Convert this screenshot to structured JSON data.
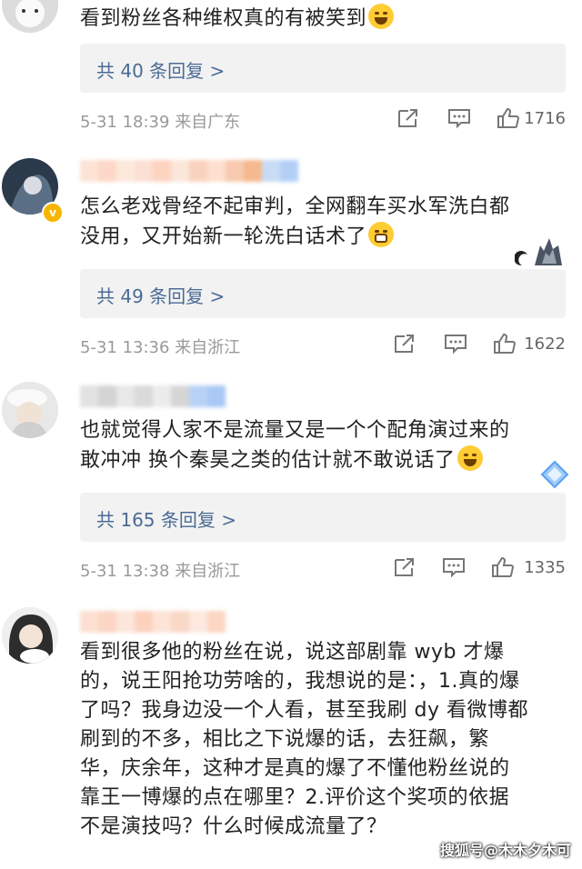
{
  "comments": [
    {
      "text": "看到粉丝各种维权真的有被笑到",
      "replies_label": "共 40 条回复 >",
      "time": "5-31 18:39",
      "location": "来自广东",
      "likes": "1716"
    },
    {
      "text_line1": "怎么老戏骨经不起审判，全网翻车买水军洗白都",
      "text_line2": "没用，又开始新一轮洗白话术了",
      "replies_label": "共 49 条回复 >",
      "time": "5-31 13:36",
      "location": "来自浙江",
      "likes": "1622"
    },
    {
      "text_line1": "也就觉得人家不是流量又是一个个配角演过来的",
      "text_line2": "敢冲冲  换个秦昊之类的估计就不敢说话了",
      "replies_label": "共 165 条回复 >",
      "time": "5-31 13:38",
      "location": "来自浙江",
      "likes": "1335"
    },
    {
      "lines": [
        "看到很多他的粉丝在说，说这部剧靠 wyb 才爆",
        "的，说王阳抢功劳啥的，我想说的是：，1.真的爆",
        "了吗？我身边没一个人看，甚至我刷 dy 看微博都",
        "刷到的不多，相比之下说爆的话，去狂飙，繁",
        "华，庆余年，这种才是真的爆了不懂他粉丝说的",
        "靠王一博爆的点在哪里？2.评价这个奖项的依据",
        "不是演技吗？什么时候成流量了？"
      ]
    }
  ],
  "watermark": "搜狐号@木木夕木可",
  "colors": {
    "link": "#4b6b95",
    "meta": "#999999",
    "reply_bg": "#f2f2f2"
  }
}
